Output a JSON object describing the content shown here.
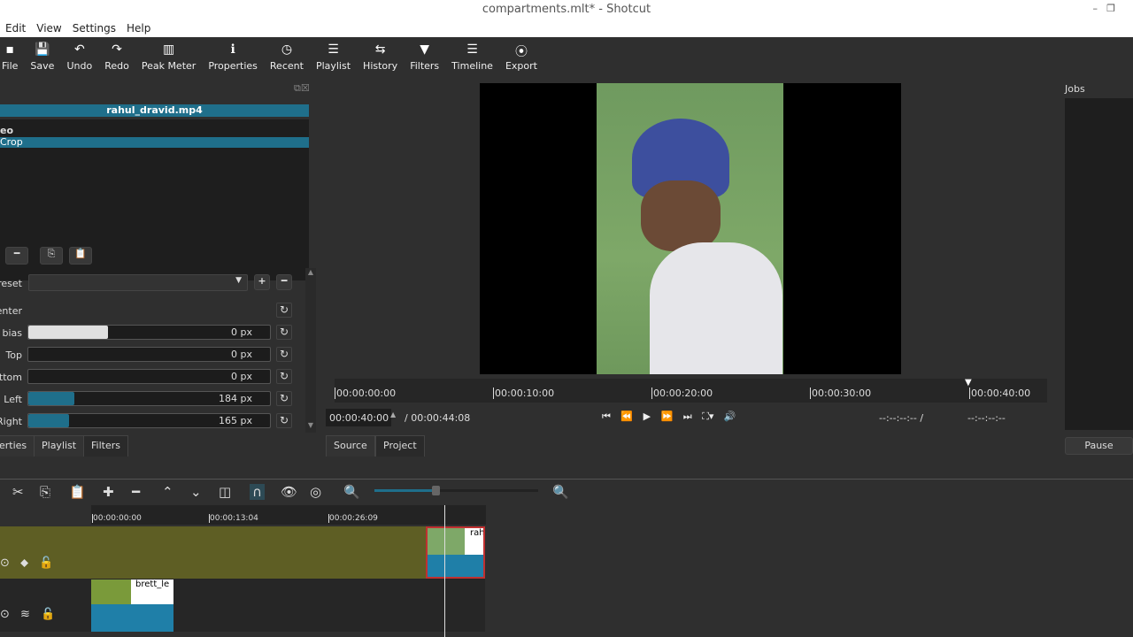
{
  "window": {
    "title": "compartments.mlt* - Shotcut"
  },
  "menu": [
    "Edit",
    "View",
    "Settings",
    "Help"
  ],
  "toolbar": [
    {
      "label": "File",
      "icon": "file-icon"
    },
    {
      "label": "Save",
      "icon": "save-icon"
    },
    {
      "label": "Undo",
      "icon": "undo-icon"
    },
    {
      "label": "Redo",
      "icon": "redo-icon"
    },
    {
      "label": "Peak Meter",
      "icon": "peak-meter-icon"
    },
    {
      "label": "Properties",
      "icon": "info-icon"
    },
    {
      "label": "Recent",
      "icon": "clock-icon"
    },
    {
      "label": "Playlist",
      "icon": "list-icon"
    },
    {
      "label": "History",
      "icon": "history-icon"
    },
    {
      "label": "Filters",
      "icon": "funnel-icon"
    },
    {
      "label": "Timeline",
      "icon": "timeline-icon"
    },
    {
      "label": "Export",
      "icon": "export-icon"
    }
  ],
  "filters": {
    "clip": "rahul_dravid.mp4",
    "section": "eo",
    "selected_filter": "Crop",
    "preset_label": "reset",
    "preset_value": "",
    "params": [
      {
        "label": "enter"
      },
      {
        "label": "r bias",
        "value": "0 px",
        "fill": 0.33,
        "color": "#e0e0e0"
      },
      {
        "label": "Top",
        "value": "0 px",
        "fill": 0
      },
      {
        "label": "ottom",
        "value": "0 px",
        "fill": 0
      },
      {
        "label": "Left",
        "value": "184 px",
        "fill": 0.19
      },
      {
        "label": "Right",
        "value": "165 px",
        "fill": 0.17
      }
    ],
    "tabs": [
      "erties",
      "Playlist",
      "Filters"
    ]
  },
  "player": {
    "ruler": [
      "00:00:00:00",
      "00:00:10:00",
      "00:00:20:00",
      "00:00:30:00",
      "00:00:40:00"
    ],
    "position": "00:00:40:00",
    "duration": "/ 00:00:44:08",
    "in_point": "--:--:--:-- /",
    "out_point": "--:--:--:--",
    "tabs": [
      "Source",
      "Project"
    ]
  },
  "jobs": {
    "title": "Jobs",
    "pause": "Pause"
  },
  "timeline": {
    "ruler": [
      "00:00:00:00",
      "00:00:13:04",
      "00:00:26:09"
    ],
    "clips": [
      "rah",
      "brett_le"
    ],
    "zoom": 0.5
  },
  "colors": {
    "accent": "#1f6f8b",
    "track": "#5e5e24"
  }
}
